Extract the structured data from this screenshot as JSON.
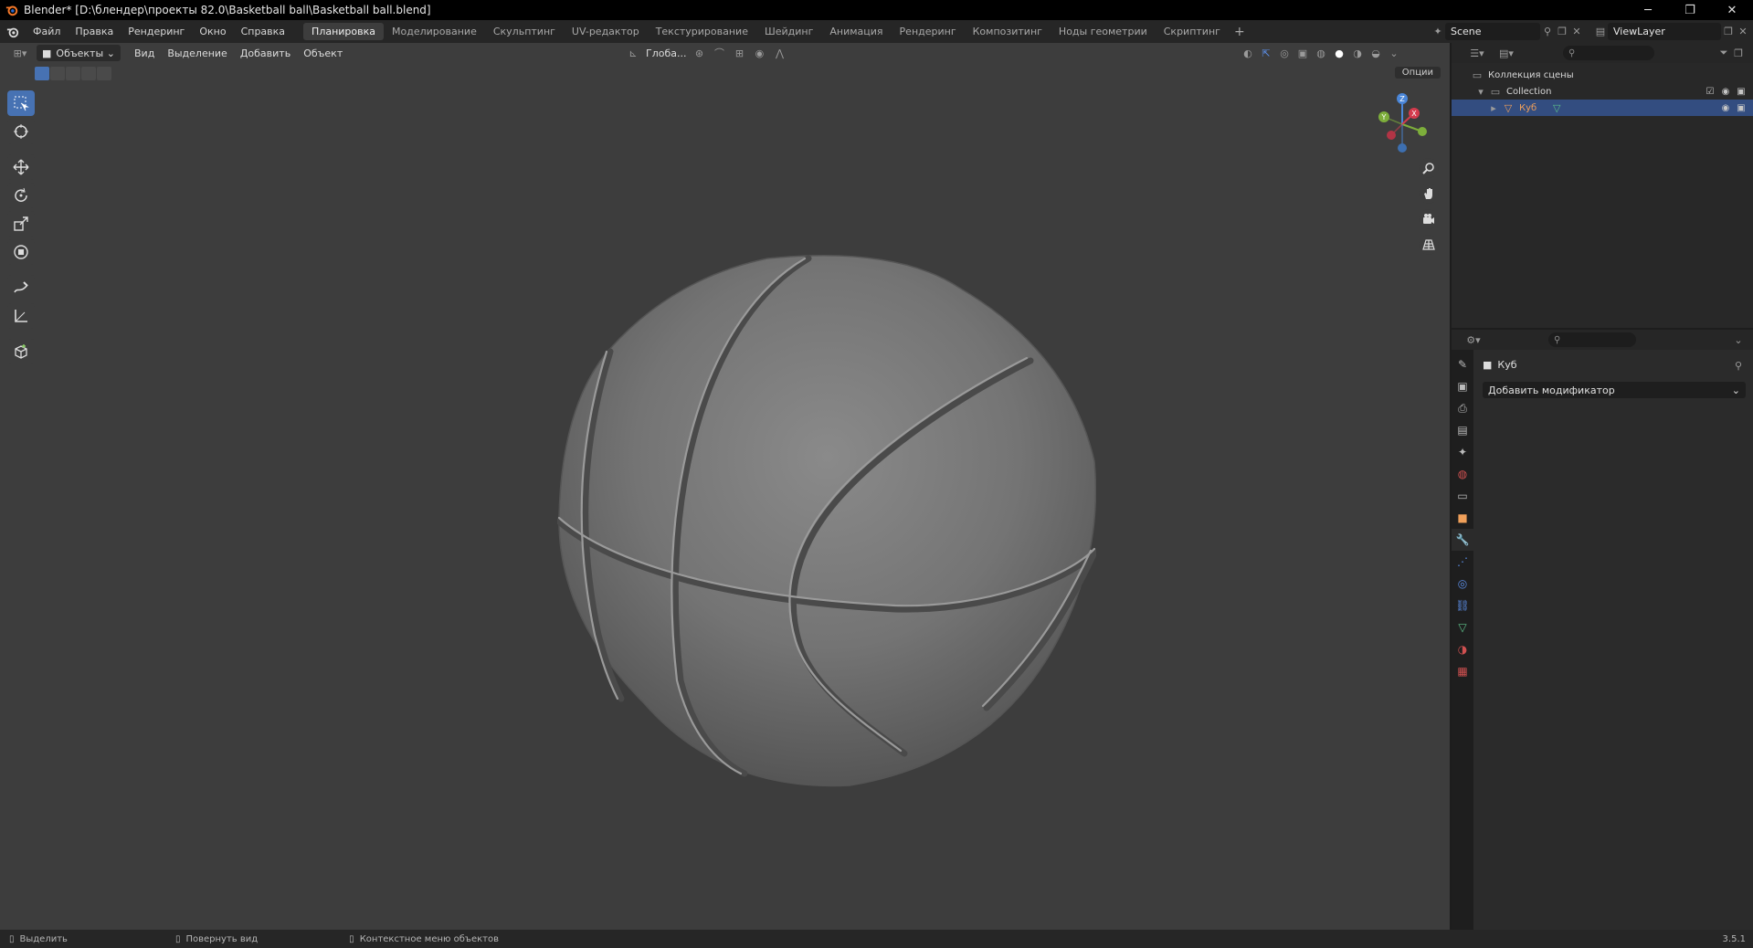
{
  "window": {
    "title": "Blender* [D:\\блендер\\проекты 82.0\\Basketball ball\\Basketball ball.blend]",
    "buttons": [
      "─",
      "❐",
      "✕"
    ]
  },
  "menubar": {
    "items": [
      "Файл",
      "Правка",
      "Рендеринг",
      "Окно",
      "Справка"
    ],
    "workspaces": [
      "Планировка",
      "Моделирование",
      "Скульптинг",
      "UV-редактор",
      "Текстурирование",
      "Шейдинг",
      "Анимация",
      "Рендеринг",
      "Композитинг",
      "Ноды геометрии",
      "Скриптинг"
    ],
    "active_workspace": 0,
    "add_tab": "+",
    "scene": "Scene",
    "view_layer": "ViewLayer"
  },
  "viewport": {
    "mode": "Объекты",
    "menus": [
      "Вид",
      "Выделение",
      "Добавить",
      "Объект"
    ],
    "orientation": "Глоба...",
    "options": "Опции",
    "gizmo": {
      "x": "X",
      "y": "Y",
      "z": "Z"
    }
  },
  "outliner": {
    "root": "Коллекция сцены",
    "collection": "Collection",
    "object": "Куб"
  },
  "properties": {
    "object_name": "Куб",
    "add_modifier": "Добавить модификатор"
  },
  "statusbar": {
    "select": "Выделить",
    "rotate": "Повернуть вид",
    "context": "Контекстное меню объектов",
    "version": "3.5.1"
  },
  "colors": {
    "accent": "#4772b3",
    "viewport_bg": "#3d3d3d",
    "selected_row": "#334d80"
  }
}
